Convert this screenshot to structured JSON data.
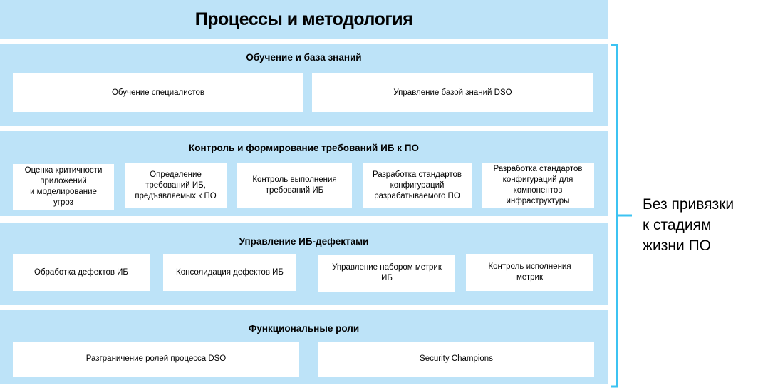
{
  "header": {
    "title": "Процессы и методология"
  },
  "sections": [
    {
      "title": "Обучение и база знаний",
      "items": [
        "Обучение специалистов",
        "Управление базой знаний DSO"
      ]
    },
    {
      "title": "Контроль и формирование требований ИБ к ПО",
      "items": [
        "Оценка критичности\nприложений\nи моделирование\nугроз",
        "Определение\nтребований ИБ,\nпредъявляемых к ПО",
        "Контроль выполнения\nтребований ИБ",
        "Разработка стандартов\nконфигураций\nразрабатываемого ПО",
        "Разработка стандартов\nконфигураций для\nкомпонентов\nинфраструктуры"
      ]
    },
    {
      "title": "Управление ИБ-дефектами",
      "items": [
        "Обработка дефектов ИБ",
        "Консолидация дефектов ИБ",
        "Управление набором метрик\nИБ",
        "Контроль исполнения\nметрик"
      ]
    },
    {
      "title": "Функциональные роли",
      "items": [
        "Разграничение ролей процесса DSO",
        "Security Champions"
      ]
    }
  ],
  "side_note": {
    "text": "Без привязки\nк стадиям\nжизни ПО"
  },
  "colors": {
    "section_bg": "#bde3f8",
    "bracket": "#3cc3f2",
    "box_bg": "#ffffff"
  }
}
